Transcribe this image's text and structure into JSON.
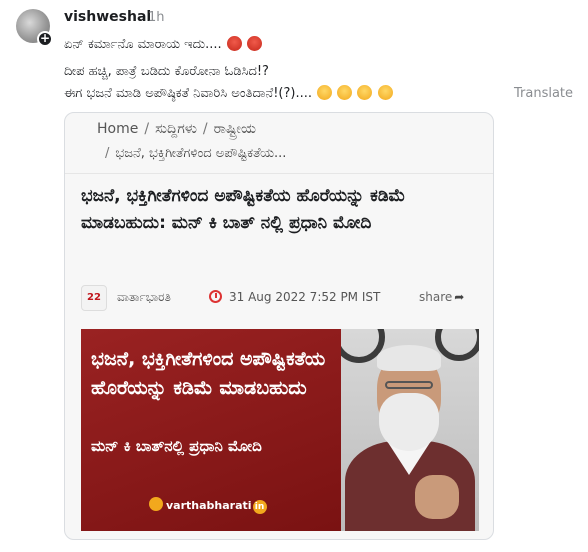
{
  "post": {
    "username": "vishweshal",
    "timestamp": "1h",
    "caption_line1": "ಏನ್ ಕರ್ಮಾನೊ ಮಾರಾಯ ಇದು....",
    "caption_line2": "ದೀಪ ಹಚ್ಚಿ, ಪಾತ್ರೆ ಬಡಿದು ಕೊರೋನಾ ಓಡಿಸಿದ!?",
    "caption_line3": "ಈಗ ಭಜನೆ ಮಾಡಿ ಅಪೌಷ್ಠಿಕತೆ ನಿವಾರಿಸಿ ಅಂತಿದಾನೆ!(?)....",
    "translate_label": "Translate"
  },
  "card": {
    "breadcrumb": [
      "Home",
      "ಸುದ್ದಿಗಳು",
      "ರಾಷ್ಟ್ರೀಯ"
    ],
    "breadcrumb_current": "ಭಜನೆ, ಭಕ್ತಿಗೀತೆಗಳಿಂದ ಅಪೌಷ್ಟಿಕತೆಯ...",
    "headline": "ಭಜನೆ, ಭಕ್ತಿಗೀತೆಗಳಿಂದ ಅಪೌಷ್ಟಿಕತೆಯ ಹೊರೆಯನ್ನು ಕಡಿಮೆ ಮಾಡಬಹುದು: ಮನ್ ಕಿ ಬಾತ್ ನಲ್ಲಿ ಪ್ರಧಾನಿ ಮೋದಿ",
    "source_logo_text": "22",
    "source_name": "ವಾರ್ತಾಭಾರತಿ",
    "date": "31 Aug 2022 7:52 PM IST",
    "share_label": "share",
    "banner_text1": "ಭಜನೆ, ಭಕ್ತಿಗೀತೆಗಳಿಂದ ಅಪೌಷ್ಟಿಕತೆಯ ಹೊರೆಯನ್ನು ಕಡಿಮೆ ಮಾಡಬಹುದು",
    "banner_text2": "ಮನ್ ಕಿ ಬಾತ್‌ನಲ್ಲಿ ಪ್ರಧಾನಿ ಮೋದಿ",
    "banner_logo": "varthabharati",
    "banner_logo_suffix": "in"
  },
  "colors": {
    "banner_maroon": "#8c1d1d",
    "emoji_angry": "#d9342b",
    "emoji_laugh": "#f5b82e",
    "clock_red": "#d33333"
  },
  "icons": [
    "add-icon",
    "angry-emoji-icon",
    "laughing-emoji-icon",
    "clock-icon",
    "share-arrow-icon"
  ]
}
